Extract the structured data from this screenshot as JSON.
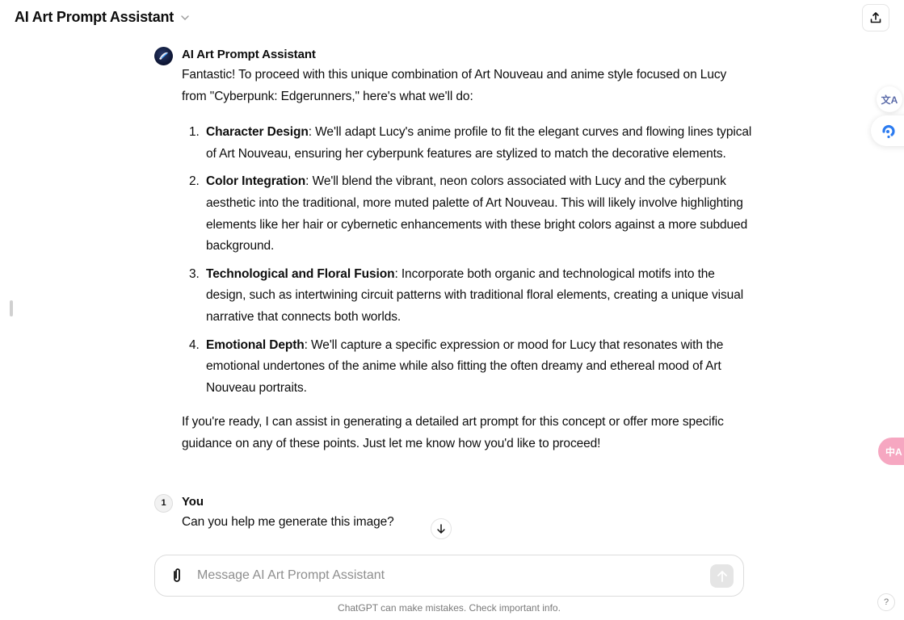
{
  "header": {
    "title": "AI Art Prompt Assistant",
    "share_icon": "share-upload-icon"
  },
  "conversation": {
    "assistant": {
      "name": "AI Art Prompt Assistant",
      "intro": "Fantastic! To proceed with this unique combination of Art Nouveau and anime style focused on Lucy from \"Cyberpunk: Edgerunners,\" here's what we'll do:",
      "steps": [
        {
          "number": "1.",
          "title": "Character Design",
          "text": ": We'll adapt Lucy's anime profile to fit the elegant curves and flowing lines typical of Art Nouveau, ensuring her cyberpunk features are stylized to match the decorative elements."
        },
        {
          "number": "2.",
          "title": "Color Integration",
          "text": ": We'll blend the vibrant, neon colors associated with Lucy and the cyberpunk aesthetic into the traditional, more muted palette of Art Nouveau. This will likely involve highlighting elements like her hair or cybernetic enhancements with these bright colors against a more subdued background."
        },
        {
          "number": "3.",
          "title": "Technological and Floral Fusion",
          "text": ": Incorporate both organic and technological motifs into the design, such as intertwining circuit patterns with traditional floral elements, creating a unique visual narrative that connects both worlds."
        },
        {
          "number": "4.",
          "title": "Emotional Depth",
          "text": ": We'll capture a specific expression or mood for Lucy that resonates with the emotional undertones of the anime while also fitting the often dreamy and ethereal mood of Art Nouveau portraits."
        }
      ],
      "outro": "If you're ready, I can assist in generating a detailed art prompt for this concept or offer more specific guidance on any of these points. Just let me know how you'd like to proceed!"
    },
    "user": {
      "name": "You",
      "avatar_text": "1",
      "message": "Can you help me generate this image?"
    }
  },
  "composer": {
    "placeholder": "Message AI Art Prompt Assistant",
    "value": ""
  },
  "footer": {
    "disclaimer": "ChatGPT can make mistakes. Check important info.",
    "help_label": "?"
  },
  "extensions": {
    "translate_label": "文A",
    "pink_translate_label": "中A"
  }
}
